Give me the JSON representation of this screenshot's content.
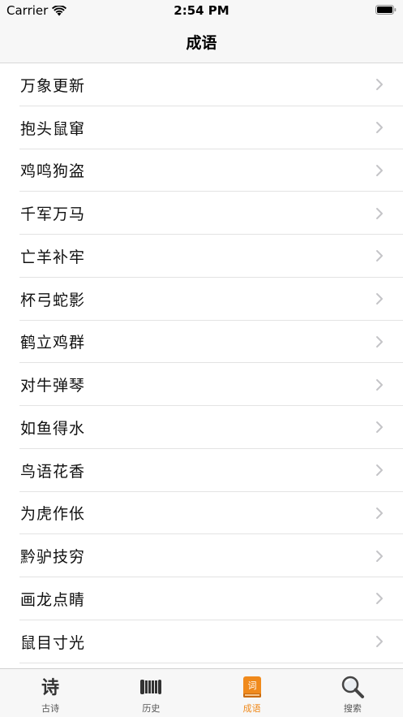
{
  "status_bar": {
    "carrier": "Carrier",
    "time": "2:54 PM"
  },
  "nav": {
    "title": "成语"
  },
  "idioms": [
    "万象更新",
    "抱头鼠窜",
    "鸡鸣狗盗",
    "千军万马",
    "亡羊补牢",
    "杯弓蛇影",
    "鹤立鸡群",
    "对牛弹琴",
    "如鱼得水",
    "鸟语花香",
    "为虎作伥",
    "黔驴技穷",
    "画龙点睛",
    "鼠目寸光"
  ],
  "tabs": [
    {
      "label": "古诗",
      "icon": "poem-icon",
      "active": false
    },
    {
      "label": "历史",
      "icon": "history-icon",
      "active": false
    },
    {
      "label": "成语",
      "icon": "idiom-book-icon",
      "active": true
    },
    {
      "label": "搜索",
      "icon": "search-icon",
      "active": false
    }
  ],
  "colors": {
    "accent": "#f08a1c",
    "bar_background": "#f7f7f7",
    "separator": "#e3e3e3",
    "chevron": "#c4c4c7"
  }
}
